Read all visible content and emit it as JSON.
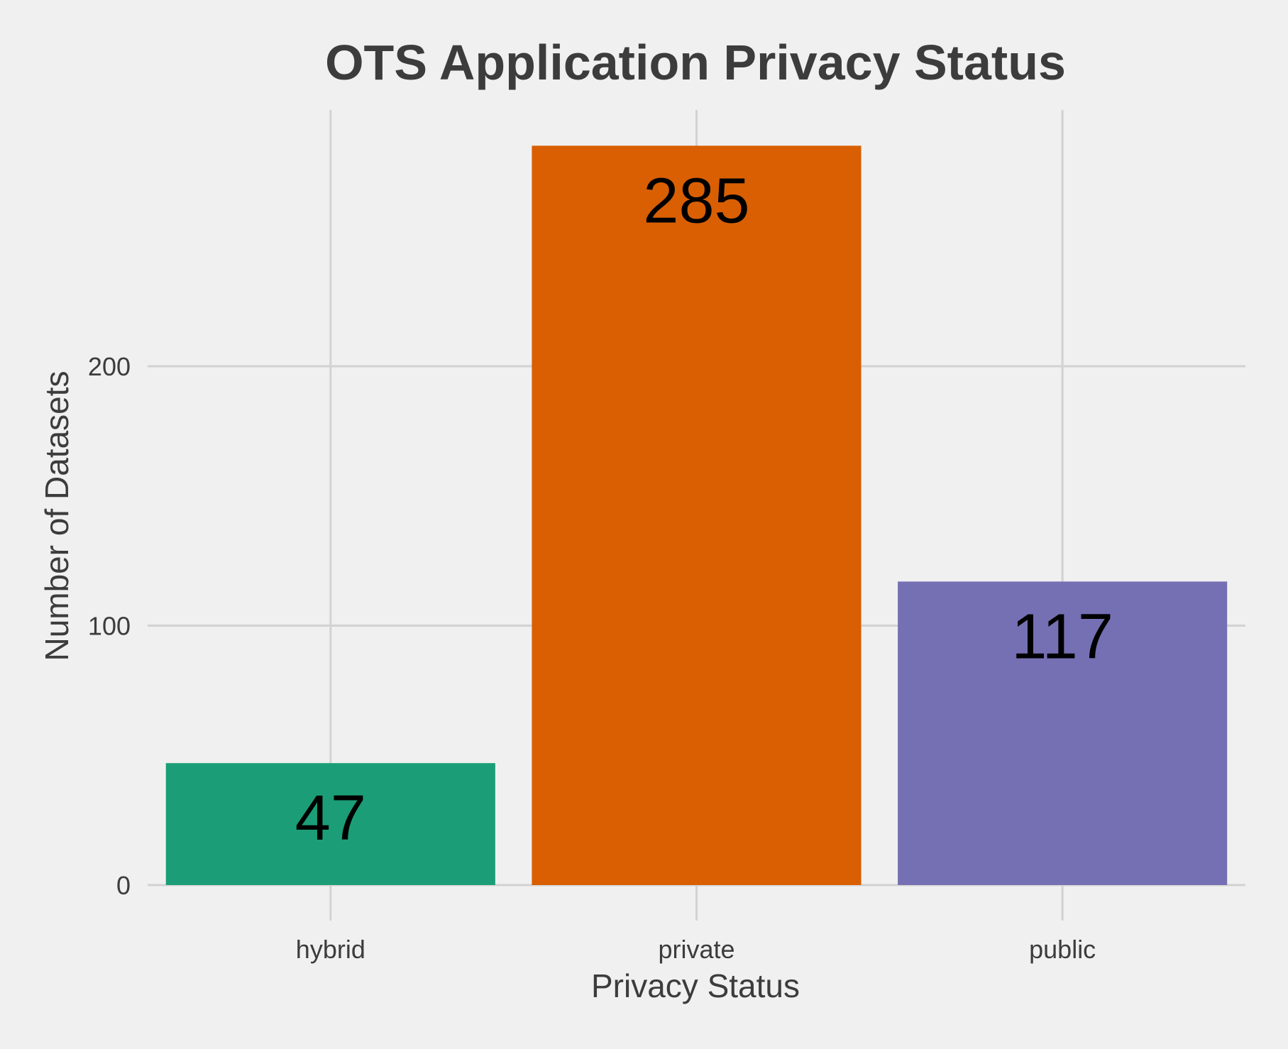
{
  "chart_data": {
    "type": "bar",
    "title": "OTS Application Privacy Status",
    "xlabel": "Privacy Status",
    "ylabel": "Number of Datasets",
    "categories": [
      "hybrid",
      "private",
      "public"
    ],
    "values": [
      47,
      285,
      117
    ],
    "colors": [
      "#1b9e77",
      "#d95f02",
      "#7570b3"
    ],
    "data_labels": [
      "47",
      "285",
      "117"
    ],
    "y_ticks": [
      0,
      100,
      200
    ],
    "y_tick_labels": [
      "0",
      "100",
      "200"
    ],
    "ylim": [
      0,
      300
    ],
    "grid": true,
    "legend": "none",
    "background": "#f0f0f0"
  }
}
